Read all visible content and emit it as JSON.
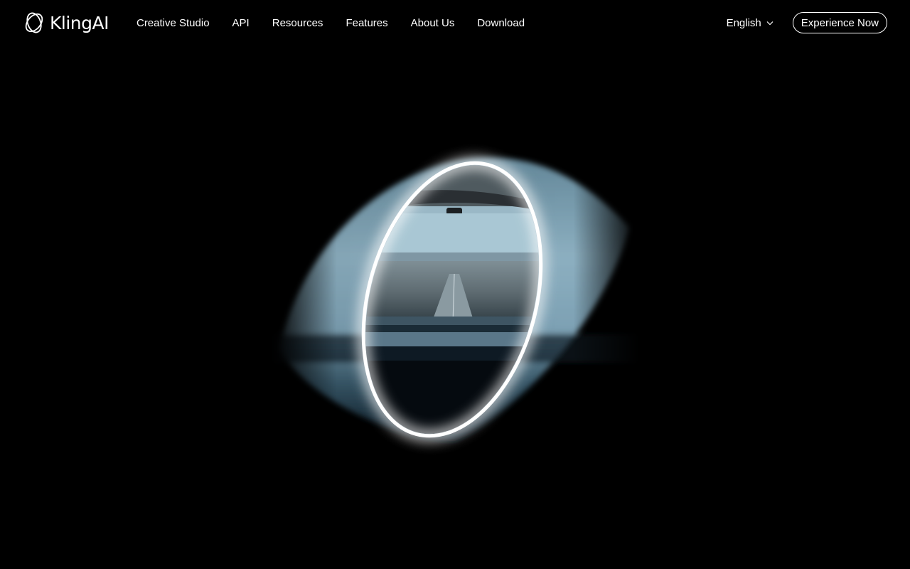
{
  "brand": {
    "name": "KlingAI",
    "logo_icon": "kling-orbit-logo-icon"
  },
  "nav": {
    "links": [
      {
        "label": "Creative Studio"
      },
      {
        "label": "API"
      },
      {
        "label": "Resources"
      },
      {
        "label": "Features"
      },
      {
        "label": "About Us"
      },
      {
        "label": "Download"
      }
    ]
  },
  "language": {
    "selected": "English",
    "icon": "chevron-down-icon"
  },
  "cta": {
    "label": "Experience Now"
  },
  "colors": {
    "background": "#000000",
    "text": "#ffffff",
    "glow": "#ffffff",
    "sky": "#7fb0c8"
  }
}
